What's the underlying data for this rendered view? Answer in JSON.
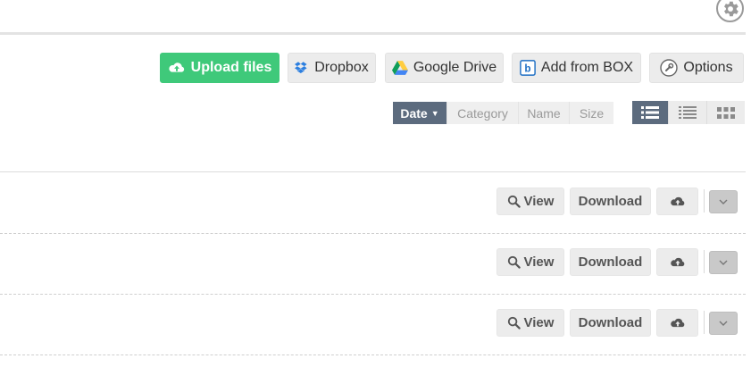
{
  "toolbar": {
    "upload_label": "Upload files",
    "dropbox_label": "Dropbox",
    "google_drive_label": "Google Drive",
    "box_label": "Add from BOX",
    "options_label": "Options"
  },
  "sort": {
    "options": [
      "Date",
      "Category",
      "Name",
      "Size"
    ],
    "active": "Date"
  },
  "view_modes": [
    "list-detail",
    "list-compact",
    "grid"
  ],
  "rows": [
    {
      "view_label": "View",
      "download_label": "Download"
    },
    {
      "view_label": "View",
      "download_label": "Download"
    },
    {
      "view_label": "View",
      "download_label": "Download"
    }
  ],
  "colors": {
    "upload_green": "#3fc97a",
    "active_slate": "#5c6b7e",
    "dropbox_blue": "#2c7fe0",
    "box_blue": "#1f6fc4"
  }
}
